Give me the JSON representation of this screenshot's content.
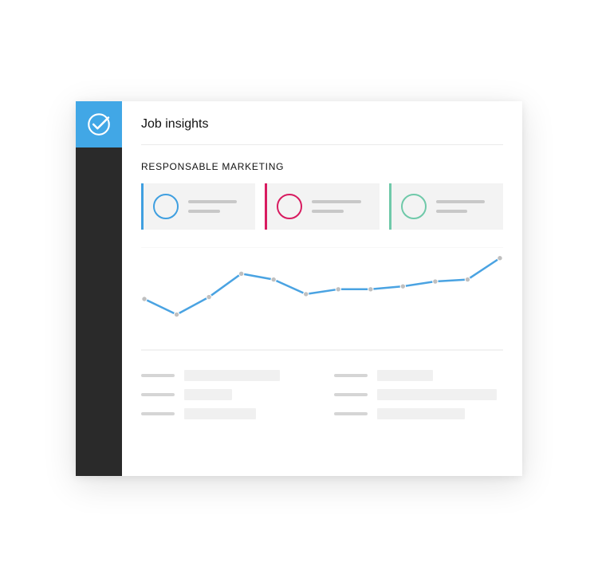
{
  "header": {
    "title": "Job insights"
  },
  "section": {
    "title": "RESPONSABLE MARKETING"
  },
  "colors": {
    "brand": "#41a7e6",
    "sidebar": "#2a2a2a",
    "card1_accent": "#3f9fe0",
    "card2_accent": "#d81b60",
    "card3_accent": "#6fc9a9",
    "chart_line": "#4aa3e2",
    "chart_point": "#bfbfbf"
  },
  "stat_cards": [
    {
      "accent": "#3f9fe0",
      "circle": "#3f9fe0"
    },
    {
      "accent": "#d81b60",
      "circle": "#d81b60"
    },
    {
      "accent": "#6fc9a9",
      "circle": "#6fc9a9"
    }
  ],
  "chart_data": {
    "type": "line",
    "x": [
      0,
      1,
      2,
      3,
      4,
      5,
      6,
      7,
      8,
      9,
      10,
      11
    ],
    "values": [
      50,
      34,
      52,
      76,
      70,
      55,
      60,
      60,
      63,
      68,
      70,
      92
    ],
    "title": "",
    "xlabel": "",
    "ylabel": "",
    "ylim": [
      0,
      100
    ]
  },
  "bottom_rows": {
    "left": [
      {
        "value_width": 120
      },
      {
        "value_width": 60
      },
      {
        "value_width": 90
      }
    ],
    "right": [
      {
        "value_width": 70
      },
      {
        "value_width": 150
      },
      {
        "value_width": 110
      }
    ]
  }
}
